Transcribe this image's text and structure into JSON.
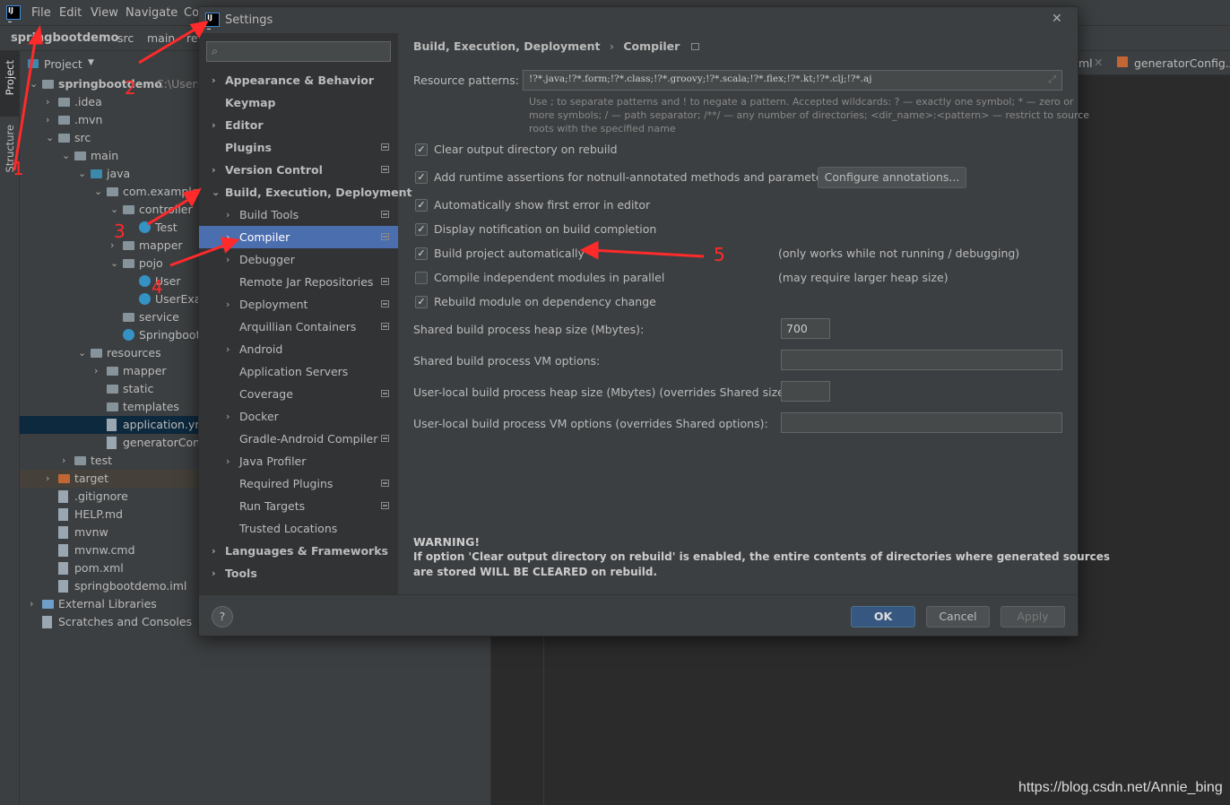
{
  "menubar": {
    "items": [
      "File",
      "Edit",
      "View",
      "Navigate",
      "Co"
    ]
  },
  "breadcrumb": [
    "springbootdemo",
    "src",
    "main",
    "re"
  ],
  "sidestrip": {
    "project": "Project",
    "structure": "Structure"
  },
  "project_panel": {
    "title": "Project",
    "root": {
      "name": "springbootdemo",
      "path": "C:\\Users"
    },
    "rows": [
      ".idea",
      ".mvn",
      "src",
      "main",
      "java",
      "com.example",
      "controller",
      "Test",
      "mapper",
      "pojo",
      "User",
      "UserExa",
      "service",
      "Springboot",
      "resources",
      "mapper",
      "static",
      "templates",
      "application.ym",
      "generatorConf",
      "test",
      "target",
      ".gitignore",
      "HELP.md",
      "mvnw",
      "mvnw.cmd",
      "pom.xml",
      "springbootdemo.iml",
      "External Libraries",
      "Scratches and Consoles"
    ]
  },
  "editor_tabs": [
    "ml",
    "generatorConfig.x"
  ],
  "dialog": {
    "title": "Settings",
    "search_placeholder": "",
    "tree": [
      "Appearance & Behavior",
      "Keymap",
      "Editor",
      "Plugins",
      "Version Control",
      "Build, Execution, Deployment",
      "Build Tools",
      "Compiler",
      "Debugger",
      "Remote Jar Repositories",
      "Deployment",
      "Arquillian Containers",
      "Android",
      "Application Servers",
      "Coverage",
      "Docker",
      "Gradle-Android Compiler",
      "Java Profiler",
      "Required Plugins",
      "Run Targets",
      "Trusted Locations",
      "Languages & Frameworks",
      "Tools"
    ],
    "breadcrumb": [
      "Build, Execution, Deployment",
      "Compiler"
    ],
    "resource_label": "Resource patterns:",
    "resource_value": "!?*.java;!?*.form;!?*.class;!?*.groovy;!?*.scala;!?*.flex;!?*.kt;!?*.clj;!?*.aj",
    "hint1": "Use ; to separate patterns and ! to negate a pattern. Accepted wildcards: ? — exactly one symbol; * — zero or",
    "hint2": "more symbols; / — path separator; /**/ — any number of directories; <dir_name>:<pattern> — restrict to source",
    "hint3": "roots with the specified name",
    "options": [
      {
        "label": "Clear output directory on rebuild",
        "checked": true
      },
      {
        "label": "Add runtime assertions for notnull-annotated methods and parameters",
        "checked": true
      },
      {
        "label": "Automatically show first error in editor",
        "checked": true
      },
      {
        "label": "Display notification on build completion",
        "checked": true
      },
      {
        "label": "Build project automatically",
        "checked": true,
        "note": "(only works while not running / debugging)"
      },
      {
        "label": "Compile independent modules in parallel",
        "checked": false,
        "note": "(may require larger heap size)"
      },
      {
        "label": "Rebuild module on dependency change",
        "checked": true
      }
    ],
    "configure_button": "Configure annotations...",
    "fields": [
      {
        "label": "Shared build process heap size (Mbytes):",
        "value": "700"
      },
      {
        "label": "Shared build process VM options:",
        "value": ""
      },
      {
        "label": "User-local build process heap size (Mbytes) (overrides Shared size):",
        "value": ""
      },
      {
        "label": "User-local build process VM options (overrides Shared options):",
        "value": ""
      }
    ],
    "warning_title": "WARNING!",
    "warning_line1": "If option 'Clear output directory on rebuild' is enabled, the entire contents of directories where generated sources",
    "warning_line2": "are stored WILL BE CLEARED on rebuild.",
    "help": "?",
    "ok": "OK",
    "cancel": "Cancel",
    "apply": "Apply"
  },
  "annotations": [
    "1",
    "2",
    "3",
    "4",
    "5"
  ],
  "watermark": "https://blog.csdn.net/Annie_bing",
  "colors": {
    "selection": "#4b6eaf",
    "annotation": "#ff2a2a"
  }
}
